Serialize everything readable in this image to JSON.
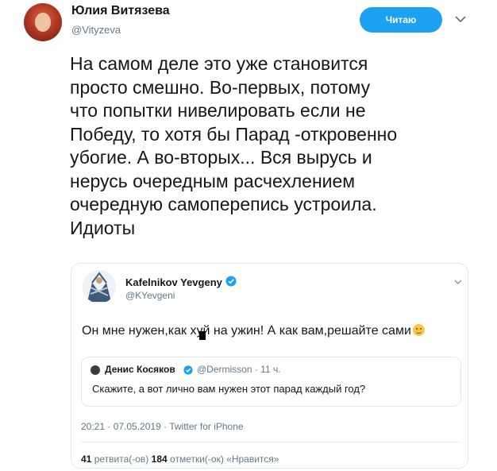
{
  "author": {
    "display_name": "Юлия Витязева",
    "username": "@Vityzeva",
    "follow_label": "Читаю"
  },
  "tweet": {
    "text": "На самом деле это уже становится\nпросто смешно. Во-первых, потому\nчто попытки нивелировать если не\nПобеду, то хотя бы Парад -откровенно\nубогие. А во-вторых... Вся вырусь и\nнерусь очередным расчехлением\nочередную самоперепись устроила.\nИдиоты"
  },
  "quoted": {
    "display_name": "Kafelnikov Yevgeny",
    "username": "@KYevgeni",
    "text": "Он мне нужен,как хуй на ужин! А как вам,решайте сами",
    "timestamp": "20:21 · 07.05.2019 · Twitter for iPhone",
    "stats": {
      "retweets_count": "41",
      "retweets_label": "ретвита(-ов)",
      "likes_count": "184",
      "likes_label": "отметки(-ок) «Нравится»"
    }
  },
  "nested_quote": {
    "display_name": "Денис Косяков",
    "username": "@Dermisson",
    "time": "· 11 ч.",
    "text": "Скажите, а вот лично вам нужен этот парад каждый год?"
  },
  "colors": {
    "accent": "#1da1f2",
    "text_primary": "#14171a",
    "text_secondary": "#657786",
    "border": "#e1e8ed"
  },
  "icons": [
    "chevron-down-icon",
    "verified-icon",
    "wink-emoji-icon"
  ]
}
